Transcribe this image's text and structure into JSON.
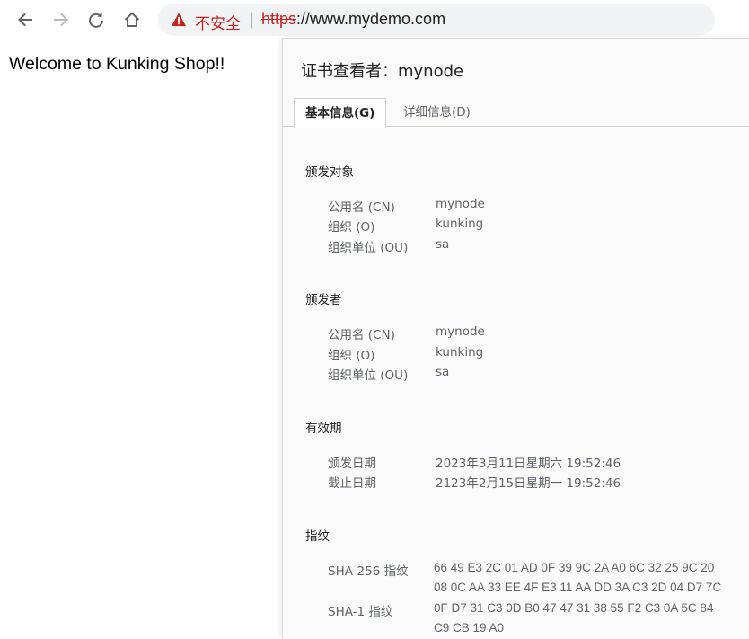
{
  "browser": {
    "security_label": "不安全",
    "separator": "|",
    "url_scheme": "https",
    "url_rest": "://www.mydemo.com"
  },
  "page": {
    "welcome": "Welcome to Kunking Shop!!"
  },
  "certificate": {
    "title": "证书查看者：mynode",
    "tabs": [
      {
        "label": "基本信息(G)",
        "active": true
      },
      {
        "label": "详细信息(D)",
        "active": false
      }
    ],
    "issued_to": {
      "heading": "颁发对象",
      "rows": [
        {
          "label": "公用名 (CN)",
          "value": "mynode"
        },
        {
          "label": "组织 (O)",
          "value": "kunking"
        },
        {
          "label": "组织单位 (OU)",
          "value": "sa"
        }
      ]
    },
    "issued_by": {
      "heading": "颁发者",
      "rows": [
        {
          "label": "公用名 (CN)",
          "value": "mynode"
        },
        {
          "label": "组织 (O)",
          "value": "kunking"
        },
        {
          "label": "组织单位 (OU)",
          "value": "sa"
        }
      ]
    },
    "validity": {
      "heading": "有效期",
      "rows": [
        {
          "label": "颁发日期",
          "value": "2023年3月11日星期六 19:52:46"
        },
        {
          "label": "截止日期",
          "value": "2123年2月15日星期一 19:52:46"
        }
      ]
    },
    "fingerprints": {
      "heading": "指纹",
      "sha256_label": "SHA-256 指纹",
      "sha256_line1": "66 49 E3 2C 01 AD 0F 39 9C 2A A0 6C 32 25 9C 20",
      "sha256_line2": "08 0C AA 33 EE 4F E3 11 AA DD 3A C3 2D 04 D7 7C",
      "sha1_label": "SHA-1 指纹",
      "sha1_line1": "0F D7 31 C3 0D B0 47 47 31 38 55 F2 C3 0A 5C 84",
      "sha1_line2": "C9 CB 19 A0"
    }
  },
  "colors": {
    "warning": "#c5221f",
    "omnibox_bg": "#f1f3f4",
    "dialog_bg": "#fafafa",
    "muted_text": "#5f6368"
  },
  "icons": [
    "back-arrow-icon",
    "forward-arrow-icon",
    "reload-icon",
    "home-icon",
    "warning-triangle-icon"
  ]
}
